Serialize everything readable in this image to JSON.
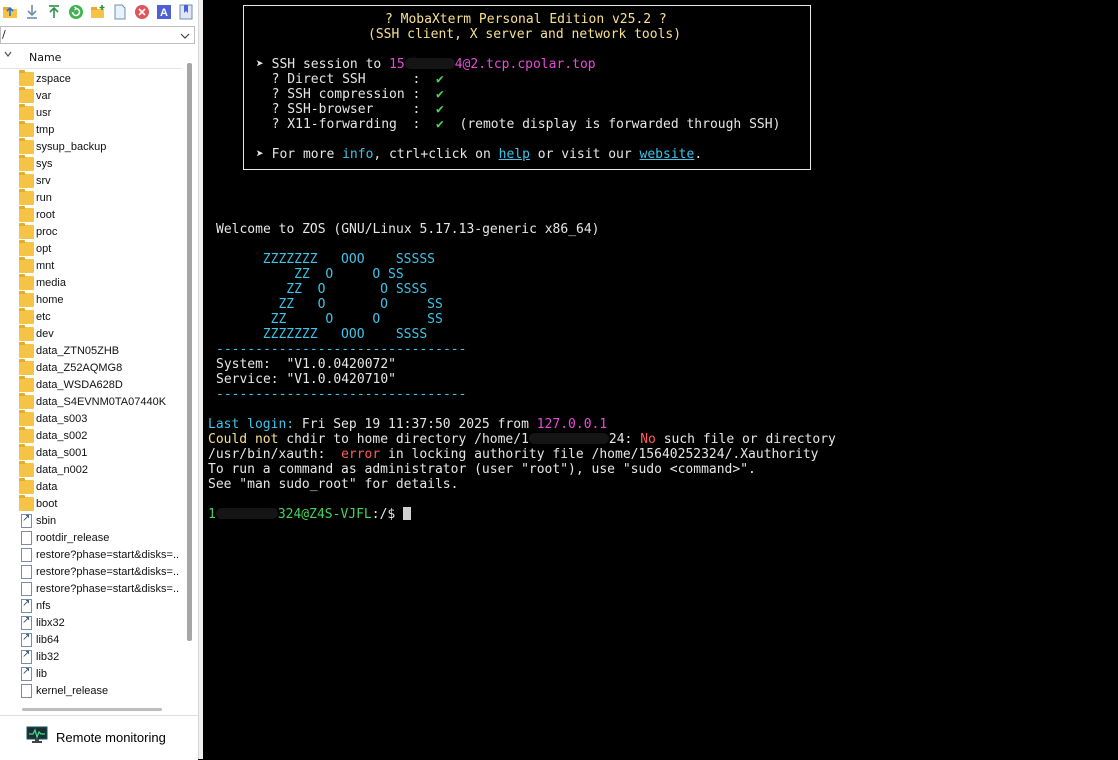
{
  "sftp": {
    "path_value": "/",
    "column_header": "Name",
    "items": [
      {
        "name": "zspace",
        "type": "folder"
      },
      {
        "name": "var",
        "type": "folder"
      },
      {
        "name": "usr",
        "type": "folder"
      },
      {
        "name": "tmp",
        "type": "folder"
      },
      {
        "name": "sysup_backup",
        "type": "folder"
      },
      {
        "name": "sys",
        "type": "folder"
      },
      {
        "name": "srv",
        "type": "folder"
      },
      {
        "name": "run",
        "type": "folder"
      },
      {
        "name": "root",
        "type": "folder"
      },
      {
        "name": "proc",
        "type": "folder"
      },
      {
        "name": "opt",
        "type": "folder"
      },
      {
        "name": "mnt",
        "type": "folder"
      },
      {
        "name": "media",
        "type": "folder"
      },
      {
        "name": "home",
        "type": "folder"
      },
      {
        "name": "etc",
        "type": "folder"
      },
      {
        "name": "dev",
        "type": "folder"
      },
      {
        "name": "data_ZTN05ZHB",
        "type": "folder"
      },
      {
        "name": "data_Z52AQMG8",
        "type": "folder"
      },
      {
        "name": "data_WSDA628D",
        "type": "folder"
      },
      {
        "name": "data_S4EVNM0TA07440K",
        "type": "folder"
      },
      {
        "name": "data_s003",
        "type": "folder"
      },
      {
        "name": "data_s002",
        "type": "folder"
      },
      {
        "name": "data_s001",
        "type": "folder"
      },
      {
        "name": "data_n002",
        "type": "folder"
      },
      {
        "name": "data",
        "type": "folder"
      },
      {
        "name": "boot",
        "type": "folder"
      },
      {
        "name": "sbin",
        "type": "link"
      },
      {
        "name": "rootdir_release",
        "type": "file"
      },
      {
        "name": "restore?phase=start&disks=...",
        "type": "file"
      },
      {
        "name": "restore?phase=start&disks=...",
        "type": "file"
      },
      {
        "name": "restore?phase=start&disks=...",
        "type": "file"
      },
      {
        "name": "nfs",
        "type": "link"
      },
      {
        "name": "libx32",
        "type": "link"
      },
      {
        "name": "lib64",
        "type": "link"
      },
      {
        "name": "lib32",
        "type": "link"
      },
      {
        "name": "lib",
        "type": "link"
      },
      {
        "name": "kernel_release",
        "type": "file"
      }
    ],
    "remote_monitoring_label": "Remote monitoring"
  },
  "terminal": {
    "banner": {
      "title": "? MobaXterm Personal Edition v25.2 ?",
      "subtitle": "(SSH client, X server and network tools)",
      "ssh_prefix": "➤ SSH session to ",
      "ssh_target_start": "15",
      "ssh_target_end": "4@2.tcp.cpolar.top",
      "features": [
        {
          "label": "  ? Direct SSH      :  ",
          "status": "✔",
          "note": ""
        },
        {
          "label": "  ? SSH compression :  ",
          "status": "✔",
          "note": ""
        },
        {
          "label": "  ? SSH-browser     :  ",
          "status": "✔",
          "note": ""
        },
        {
          "label": "  ? X11-forwarding  :  ",
          "status": "✔",
          "note": "  (remote display is forwarded through SSH)"
        }
      ],
      "more_prefix": "➤ For more ",
      "more_info": "info",
      "more_mid": ", ctrl+click on ",
      "more_help": "help",
      "more_or": " or visit our ",
      "more_site": "website",
      "more_end": "."
    },
    "welcome": "Welcome to ZOS (GNU/Linux 5.17.13-generic x86_64)",
    "ascii_art": [
      "       ZZZZZZZ   OOO    SSSSS",
      "           ZZ  O     O SS",
      "          ZZ  O       O SSSS",
      "         ZZ   O       O     SS",
      "        ZZ     O     O      SS",
      "       ZZZZZZZ   OOO    SSSS"
    ],
    "rule": "--------------------------------",
    "system_line": "System:  \"V1.0.0420072\"",
    "service_line": "Service: \"V1.0.0420710\"",
    "last_login_label": "Last login:",
    "last_login_text": " Fri Sep 19 11:37:50 2025 from ",
    "last_login_ip": "127.0.0.1",
    "could_not": "Could not",
    "chdir_text": " chdir to home directory /home/1",
    "chdir_end": "24:",
    "no_text": " No",
    "no_rest": " such file or directory",
    "xauth_prefix": "/usr/bin/xauth:  ",
    "xauth_error": "error",
    "xauth_rest": " in locking authority file /home/15640252324/.Xauthority",
    "admin_line": "To run a command as administrator (user \"root\"), use \"sudo <command>\".",
    "man_line": "See \"man sudo_root\" for details.",
    "prompt_user_start": "1",
    "prompt_user_end": "324@Z4S-VJFL",
    "prompt_path": ":/",
    "prompt_dollar": "$ "
  }
}
